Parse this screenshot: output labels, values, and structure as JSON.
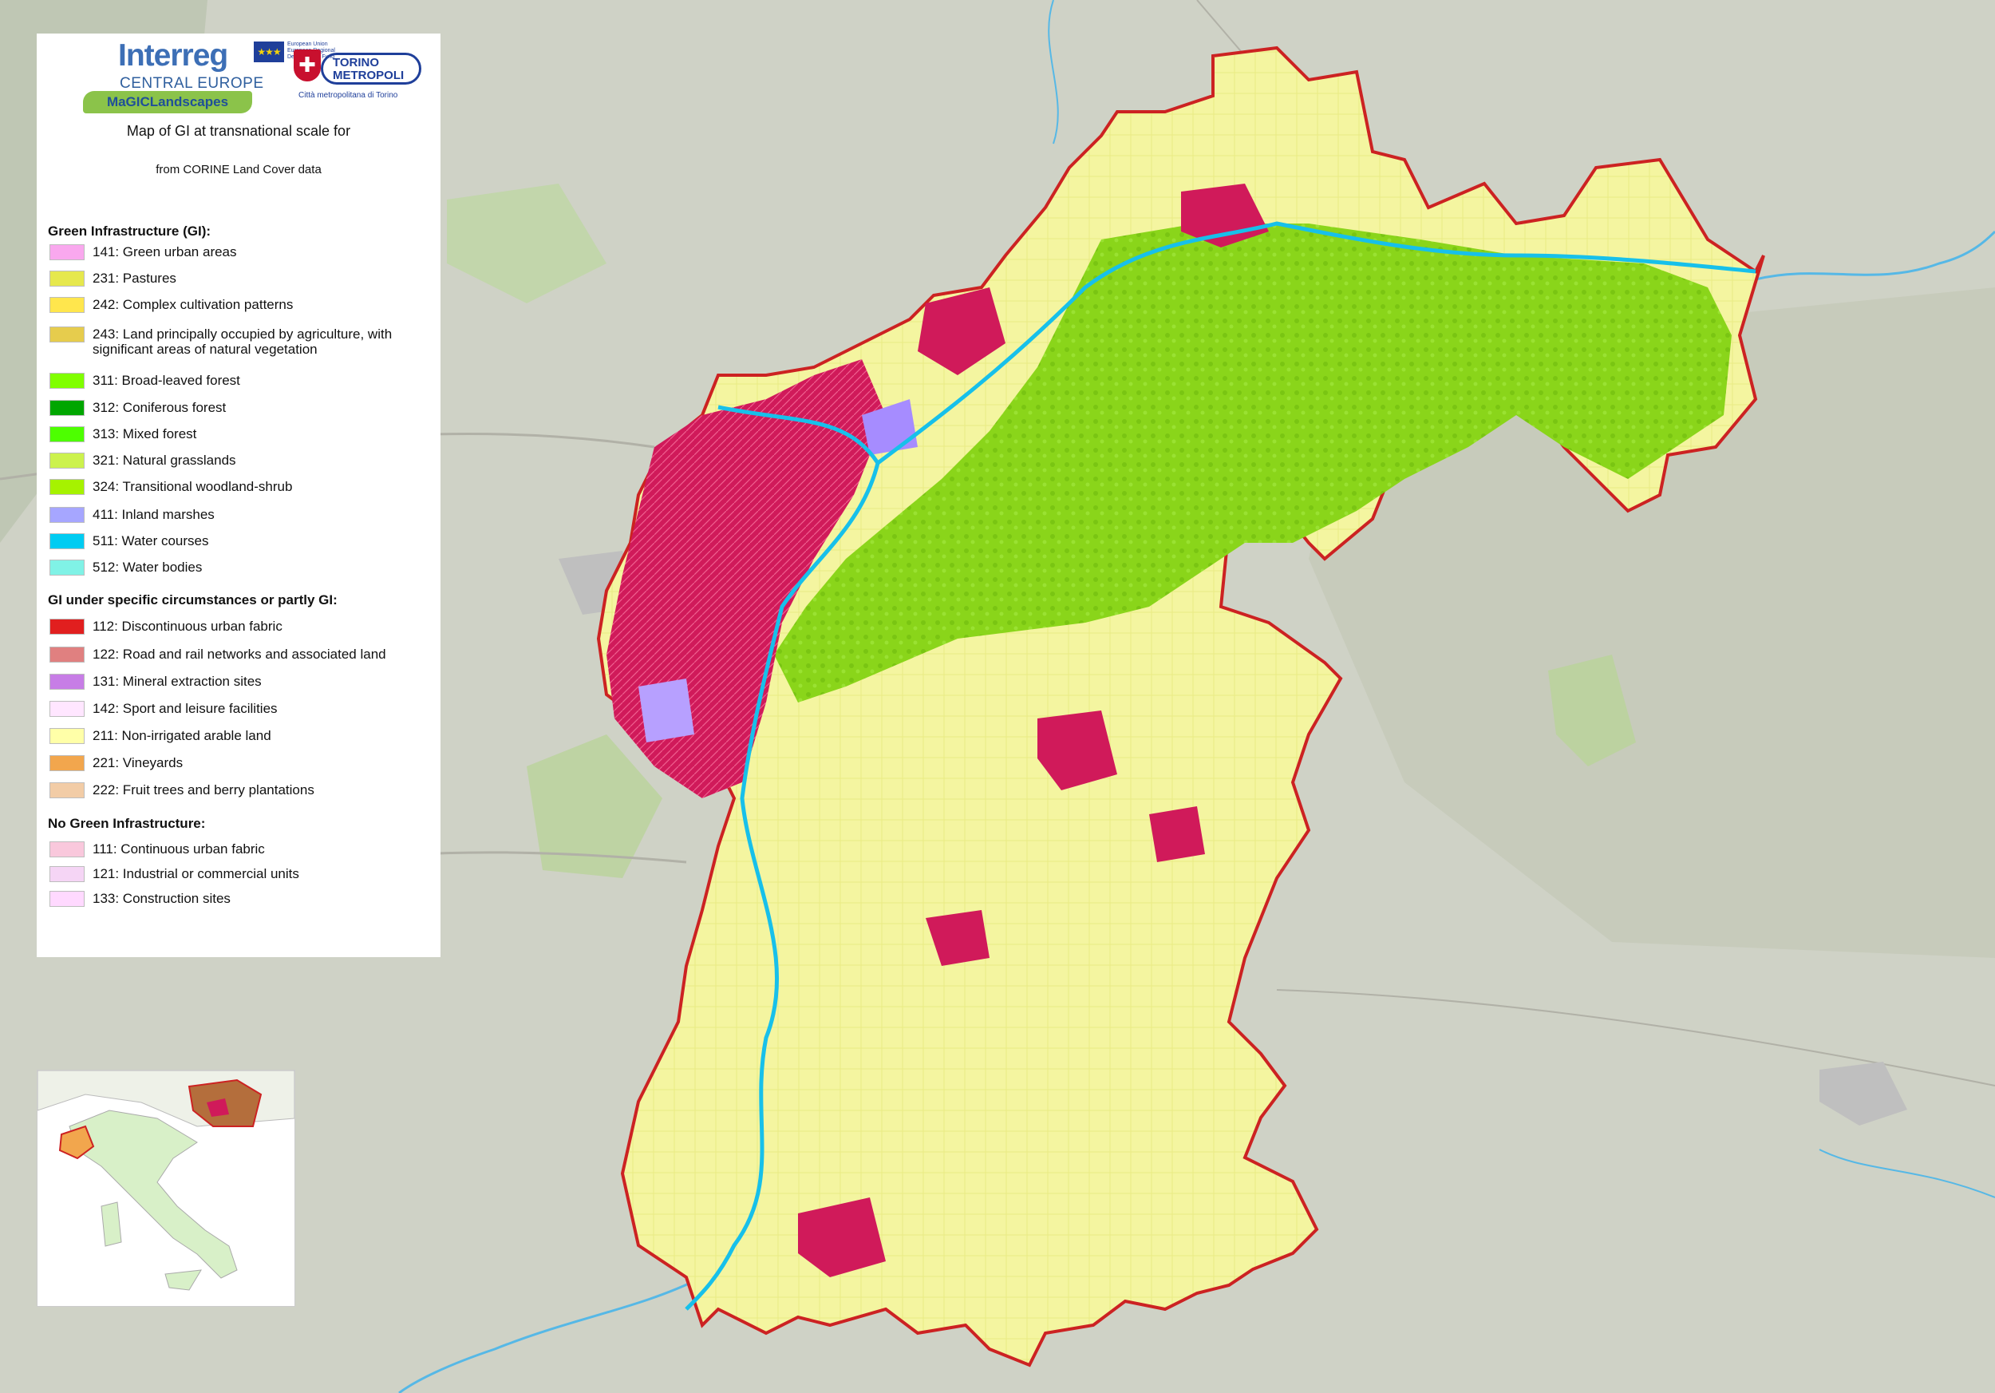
{
  "logos": {
    "interreg": "Interreg",
    "central_europe": "CENTRAL EUROPE",
    "eu_fund": "European Union European Regional Development Fund",
    "magic": "MaGICLandscapes",
    "torino_name": "TORINO METROPOLI",
    "torino_sub": "Città metropolitana di Torino"
  },
  "legend": {
    "title_line1": "Map of GI at transnational scale for",
    "title_line2": "from CORINE Land Cover data",
    "sections": [
      {
        "heading": "Green Infrastructure (GI):",
        "items": [
          {
            "code": "141",
            "label": "141: Green urban areas",
            "color": "#f9a8ee"
          },
          {
            "code": "231",
            "label": "231: Pastures",
            "color": "#e6e84d"
          },
          {
            "code": "242",
            "label": "242: Complex cultivation patterns",
            "color": "#ffe64d"
          },
          {
            "code": "243",
            "label": "243: Land principally occupied by agriculture, with significant areas of natural vegetation",
            "color": "#e6cc4d"
          },
          {
            "code": "311",
            "label": "311: Broad-leaved forest",
            "color": "#80ff00"
          },
          {
            "code": "312",
            "label": "312: Coniferous forest",
            "color": "#00a600"
          },
          {
            "code": "313",
            "label": "313: Mixed forest",
            "color": "#4dff00"
          },
          {
            "code": "321",
            "label": "321: Natural grasslands",
            "color": "#ccf24d"
          },
          {
            "code": "324",
            "label": "324: Transitional woodland-shrub",
            "color": "#a6f200"
          },
          {
            "code": "411",
            "label": "411: Inland marshes",
            "color": "#a6a6ff"
          },
          {
            "code": "511",
            "label": "511: Water courses",
            "color": "#00ccf2"
          },
          {
            "code": "512",
            "label": "512: Water bodies",
            "color": "#80f2e6"
          }
        ]
      },
      {
        "heading": "GI under specific circumstances or partly GI:",
        "items": [
          {
            "code": "112",
            "label": "112: Discontinuous urban fabric",
            "color": "#e11f1f"
          },
          {
            "code": "122",
            "label": "122: Road and rail networks and associated land",
            "color": "#e08080"
          },
          {
            "code": "131",
            "label": "131: Mineral extraction sites",
            "color": "#c77de6"
          },
          {
            "code": "142",
            "label": "142: Sport and leisure facilities",
            "color": "#ffe6ff"
          },
          {
            "code": "211",
            "label": "211: Non-irrigated arable land",
            "color": "#ffffa8"
          },
          {
            "code": "221",
            "label": "221: Vineyards",
            "color": "#f2a64d"
          },
          {
            "code": "222",
            "label": "222: Fruit trees and berry plantations",
            "color": "#f2cca6"
          }
        ]
      },
      {
        "heading": "No Green Infrastructure:",
        "items": [
          {
            "code": "111",
            "label": "111: Continuous urban fabric",
            "color": "#f9c8dc"
          },
          {
            "code": "121",
            "label": "121: Industrial or commercial units",
            "color": "#f5d5f5"
          },
          {
            "code": "133",
            "label": "133: Construction sites",
            "color": "#ffd9ff"
          }
        ]
      }
    ]
  },
  "map": {
    "region_border_color": "#cc2222",
    "basemap_color": "#cfd2c6"
  },
  "inset": {
    "highlight_color": "#f2a64d"
  }
}
